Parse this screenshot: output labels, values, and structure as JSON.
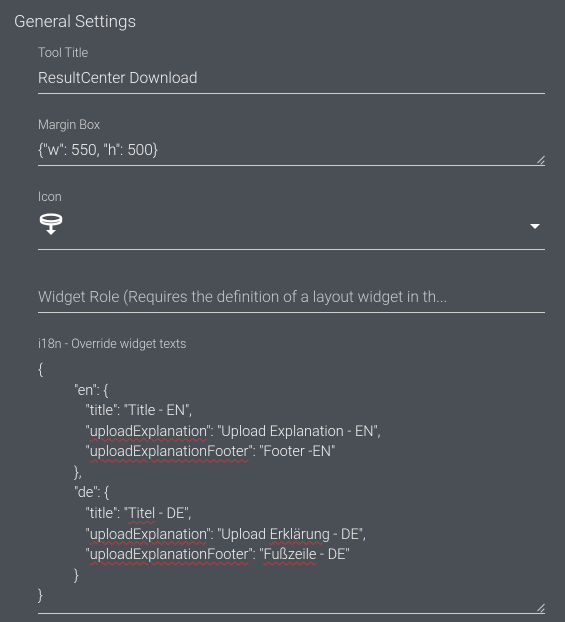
{
  "panel": {
    "title": "General Settings"
  },
  "fields": {
    "toolTitle": {
      "label": "Tool Title",
      "value": "ResultCenter Download"
    },
    "marginBox": {
      "label": "Margin Box",
      "value": "{\"w\": 550, \"h\": 500}"
    },
    "icon": {
      "label": "Icon",
      "selected": "download-stack"
    },
    "widgetRole": {
      "placeholder": "Widget Role (Requires the definition of a layout widget in th...",
      "value": ""
    },
    "i18n": {
      "label": "i18n - Override widget texts",
      "value": {
        "en": {
          "title": "Title - EN",
          "uploadExplanation": "Upload Explanation - EN",
          "uploadExplanationFooter": "Footer -EN"
        },
        "de": {
          "title": "Titel - DE",
          "uploadExplanation": "Upload Erklärung - DE",
          "uploadExplanationFooter": "Fußzeile - DE"
        }
      }
    }
  }
}
